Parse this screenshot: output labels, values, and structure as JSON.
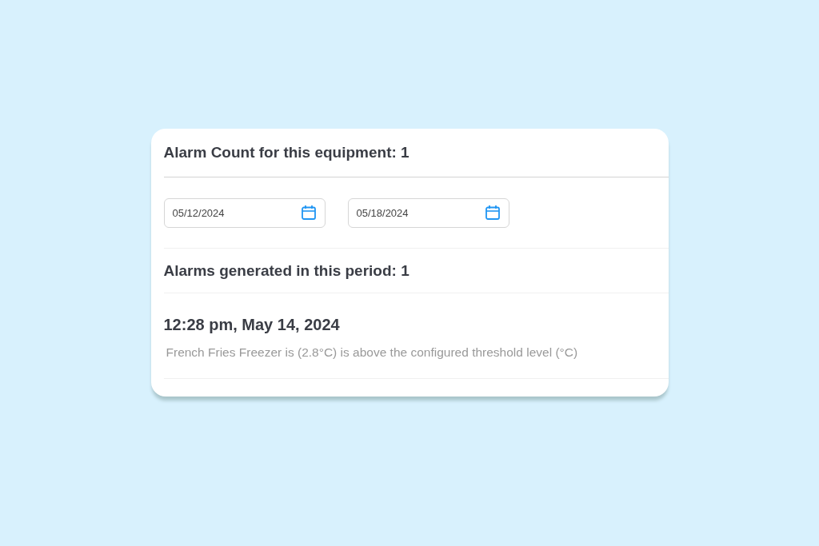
{
  "header": {
    "title": "Alarm Count for this equipment: 1"
  },
  "date_range": [
    {
      "value": "05/12/2024"
    },
    {
      "value": "05/18/2024"
    }
  ],
  "period_summary": "Alarms generated in this period: 1",
  "alarms": [
    {
      "time": "12:28 pm, May 14, 2024",
      "message": "French Fries Freezer is (2.8°C) is above the configured threshold level (°C)"
    }
  ]
}
